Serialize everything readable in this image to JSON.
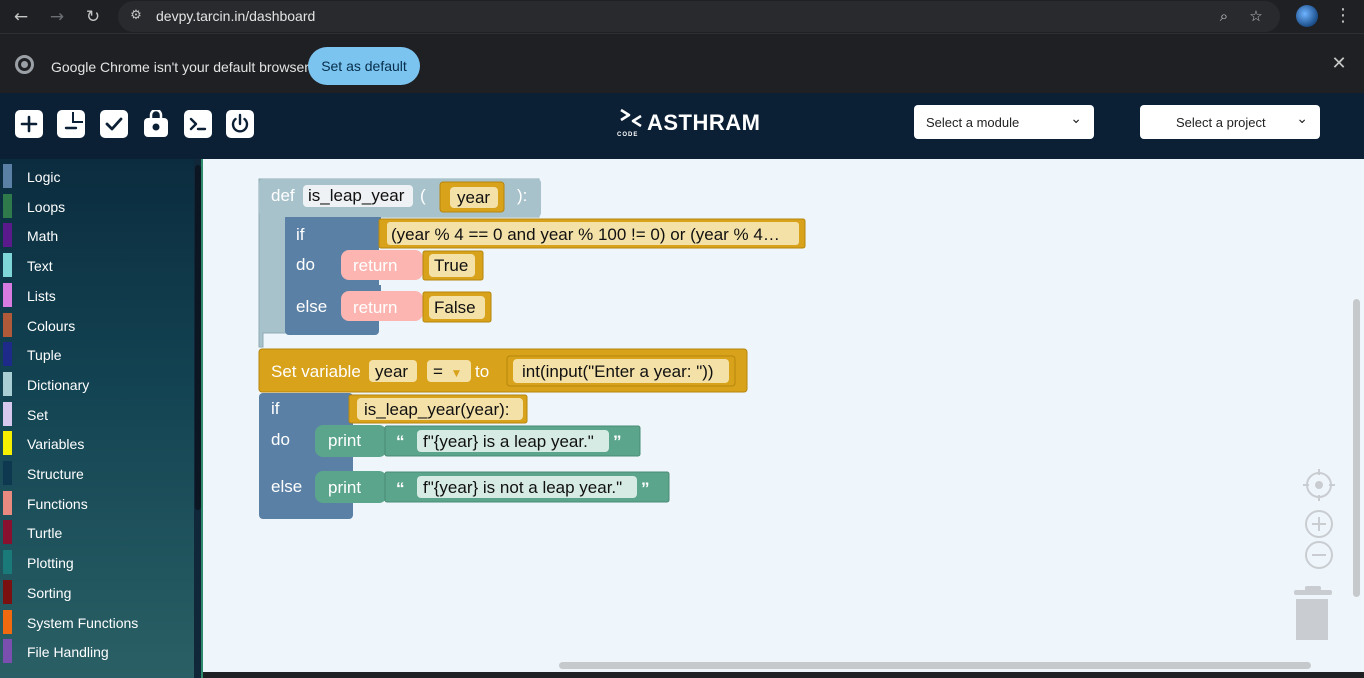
{
  "browser": {
    "url": "devpy.tarcin.in/dashboard",
    "infobar_message": "Google Chrome isn't your default browser",
    "set_default_label": "Set as default"
  },
  "header": {
    "brand": "ASTHRAM",
    "brand_sub": "CODE",
    "module_select": "Select a module",
    "project_select": "Select a project"
  },
  "toolbox": {
    "categories": [
      {
        "label": "Logic",
        "color": "#5b80a5"
      },
      {
        "label": "Loops",
        "color": "#2f7a4a"
      },
      {
        "label": "Math",
        "color": "#5b1a8c"
      },
      {
        "label": "Text",
        "color": "#7fd6d6"
      },
      {
        "label": "Lists",
        "color": "#d77be0"
      },
      {
        "label": "Colours",
        "color": "#b05a3a"
      },
      {
        "label": "Tuple",
        "color": "#1e2a8a"
      },
      {
        "label": "Dictionary",
        "color": "#a9cfd4"
      },
      {
        "label": "Set",
        "color": "#d7c8f0"
      },
      {
        "label": "Variables",
        "color": "#f5f000"
      },
      {
        "label": "Structure",
        "color": "#0e3850"
      },
      {
        "label": "Functions",
        "color": "#e88a80"
      },
      {
        "label": "Turtle",
        "color": "#8a1030"
      },
      {
        "label": "Plotting",
        "color": "#1a7a7a"
      },
      {
        "label": "Sorting",
        "color": "#7a1010"
      },
      {
        "label": "System Functions",
        "color": "#f26a10"
      },
      {
        "label": "File Handling",
        "color": "#7a4fb0"
      }
    ]
  },
  "blocks": {
    "def_keyword": "def",
    "function_name": "is_leap_year",
    "paren_open": "(",
    "param": "year",
    "paren_close": "):",
    "if_keyword": "if",
    "do_keyword": "do",
    "else_keyword": "else",
    "condition": "(year % 4 == 0 and year % 100 != 0) or (year % 4…",
    "return_keyword": "return",
    "true_value": "True",
    "false_value": "False",
    "set_variable_label": "Set variable",
    "var_name": "year",
    "op": "=",
    "to_label": "to",
    "input_expr": "int(input(\"Enter a year: \"))",
    "if2_keyword": "if",
    "call_expr": "is_leap_year(year):",
    "do2_keyword": "do",
    "print_keyword": "print",
    "print1_string": "f\"{year} is a leap year.\"",
    "else2_keyword": "else",
    "print2_string": "f\"{year} is not a leap year.\"",
    "open_quote": "“",
    "close_quote": "”"
  },
  "icons": [
    "back-icon",
    "forward-icon",
    "reload-icon",
    "site-info-icon",
    "zoom-icon",
    "star-icon",
    "new-file-icon",
    "document-icon",
    "check-icon",
    "save-bag-icon",
    "terminal-icon",
    "power-icon",
    "recenter-icon",
    "zoom-in-icon",
    "zoom-out-icon",
    "trash-icon"
  ]
}
